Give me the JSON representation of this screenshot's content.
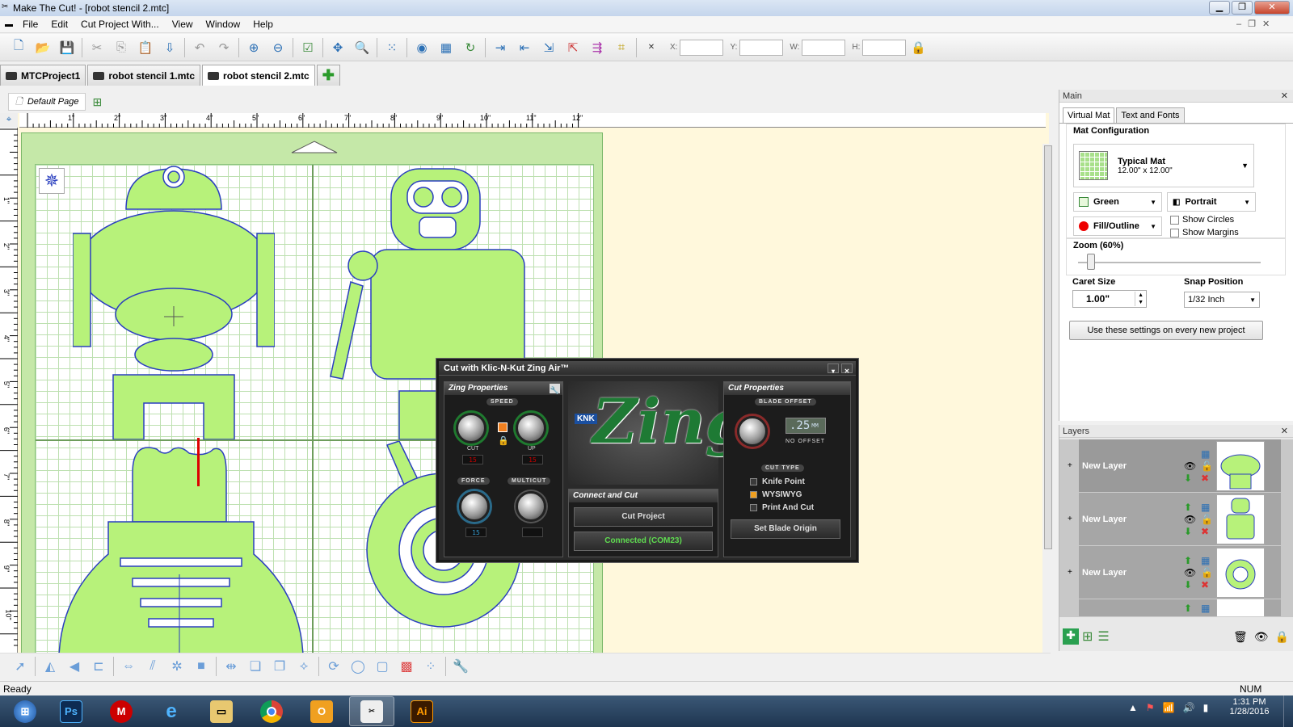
{
  "window": {
    "title": "Make The Cut! - [robot stencil 2.mtc]"
  },
  "menu": [
    "File",
    "Edit",
    "Cut Project With...",
    "View",
    "Window",
    "Help"
  ],
  "coords": {
    "x_label": "X:",
    "y_label": "Y:",
    "w_label": "W:",
    "h_label": "H:"
  },
  "tabs": [
    {
      "label": "MTCProject1"
    },
    {
      "label": "robot stencil 1.mtc"
    },
    {
      "label": "robot stencil 2.mtc"
    }
  ],
  "page": {
    "label": "Default Page"
  },
  "ruler_h": [
    "1\"",
    "2\"",
    "3\"",
    "4\"",
    "5\"",
    "6\"",
    "7\"",
    "8\"",
    "9\"",
    "10\"",
    "11\"",
    "12\""
  ],
  "ruler_v": [
    "1\"",
    "2\"",
    "3\"",
    "4\"",
    "5\"",
    "6\"",
    "7\"",
    "8\"",
    "9\"",
    "10\""
  ],
  "panel": {
    "title": "Main",
    "tabs": [
      "Virtual Mat",
      "Text and Fonts"
    ],
    "mat_config_label": "Mat Configuration",
    "mat_name": "Typical Mat",
    "mat_size": "12.00\" x 12.00\"",
    "color": "Green",
    "orientation": "Portrait",
    "fill": "Fill/Outline",
    "show_circles": "Show Circles",
    "show_margins": "Show Margins",
    "zoom_label": "Zoom (60%)",
    "zoom_value": 0.05,
    "caret_label": "Caret Size",
    "caret_value": "1.00\"",
    "snap_label": "Snap Position",
    "snap_value": "1/32 Inch",
    "use_settings": "Use these settings on every new project"
  },
  "layers": {
    "title": "Layers",
    "items": [
      {
        "name": "New Layer"
      },
      {
        "name": "New Layer"
      },
      {
        "name": "New Layer"
      }
    ]
  },
  "zing": {
    "title": "Cut with Klic-N-Kut Zing Air™",
    "props_label": "Zing Properties",
    "speed_label": "SPEED",
    "cut_label": "CUT",
    "up_label": "UP",
    "cut_value": "15",
    "up_value": "15",
    "force_label": "FORCE",
    "multicut_label": "MULTICUT",
    "force_value": "15",
    "logo_brand": "KNK",
    "logo_text": "Zing",
    "connect_label": "Connect and Cut",
    "cut_project": "Cut Project",
    "connected": "Connected (COM23)",
    "cut_props_label": "Cut Properties",
    "blade_offset_label": "BLADE OFFSET",
    "blade_offset_value": ".25",
    "blade_offset_unit": "MM",
    "no_offset": "NO OFFSET",
    "cut_type_label": "CUT TYPE",
    "cut_types": [
      "Knife Point",
      "WYSIWYG",
      "Print And Cut"
    ],
    "set_origin": "Set Blade Origin"
  },
  "status": {
    "text": "Ready",
    "num": "NUM"
  },
  "clock": {
    "time": "1:31 PM",
    "date": "1/28/2016"
  },
  "colors": {
    "accent": "#2a6fb5",
    "mat": "#c5e8a8",
    "shape_fill": "#b7f27a",
    "shape_stroke": "#2a3fbf",
    "canvas_bg": "#fff8dc"
  }
}
